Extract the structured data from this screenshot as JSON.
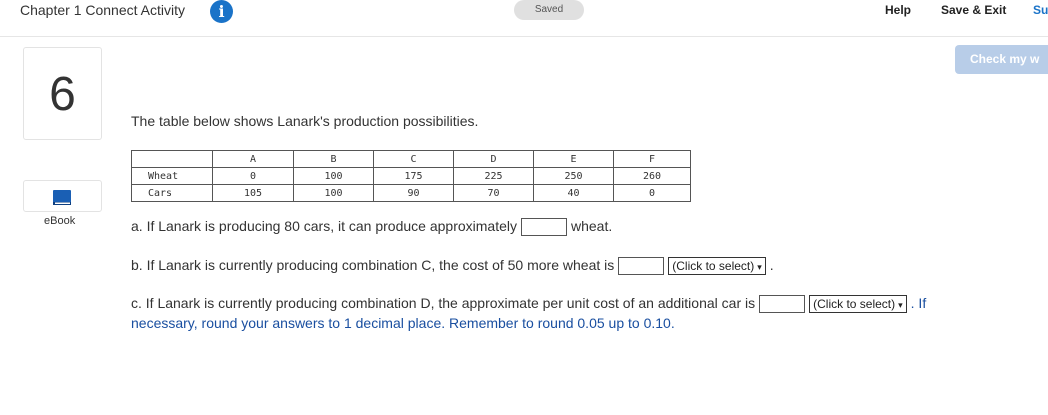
{
  "header": {
    "title": "Chapter 1 Connect Activity",
    "info_icon": "i",
    "saved": "Saved",
    "help": "Help",
    "save_exit": "Save & Exit",
    "submit": "Su"
  },
  "check_button": "Check my w",
  "question_number": "6",
  "ebook_label": "eBook",
  "prompt": "The table below shows Lanark's production possibilities.",
  "table": {
    "headers": [
      "",
      "A",
      "B",
      "C",
      "D",
      "E",
      "F"
    ],
    "rows": [
      {
        "label": "Wheat",
        "values": [
          "0",
          "100",
          "175",
          "225",
          "250",
          "260"
        ]
      },
      {
        "label": "Cars",
        "values": [
          "105",
          "100",
          "90",
          "70",
          "40",
          "0"
        ]
      }
    ]
  },
  "part_a": {
    "before": "a. If Lanark is producing 80 cars, it can produce approximately",
    "after": "wheat.",
    "value": ""
  },
  "part_b": {
    "before": "b. If Lanark is currently producing combination C, the cost of 50 more wheat is",
    "value": "",
    "select": "(Click to select)",
    "after": "."
  },
  "part_c": {
    "before": "c. If Lanark is currently producing combination D, the approximate per unit cost of an additional car is",
    "value": "",
    "select": "(Click to select)",
    "after": ". If",
    "note": "necessary, round your answers to 1 decimal place. Remember to round 0.05 up to 0.10."
  }
}
